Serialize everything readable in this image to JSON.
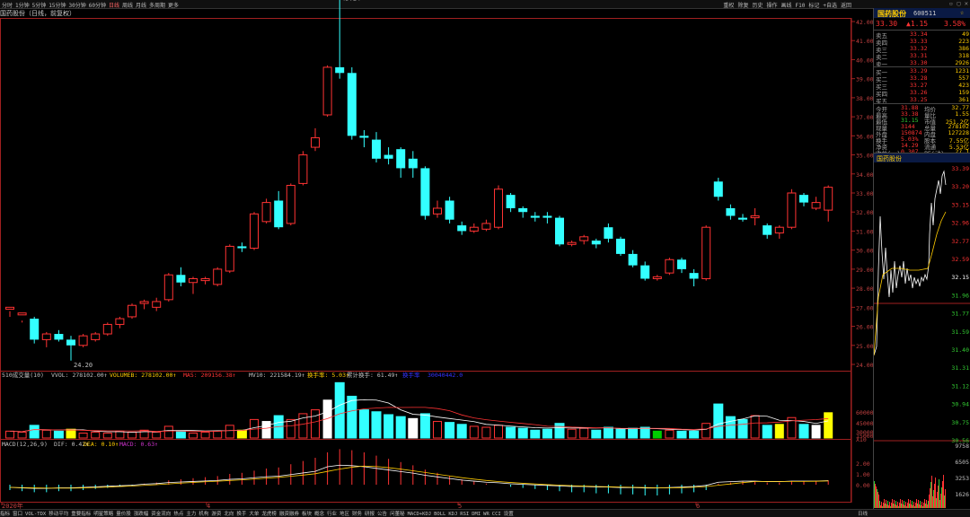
{
  "top_tabs": [
    "分时",
    "1分钟",
    "5分钟",
    "15分钟",
    "30分钟",
    "60分钟",
    "日线",
    "周线",
    "月线",
    "多周期",
    "更多"
  ],
  "top_active_tab": 6,
  "top_right_tabs": [
    "重权",
    "除复",
    "历史",
    "操作",
    "画线",
    "F10",
    "标记",
    "+自选",
    "返回"
  ],
  "stock_header": "国药股份（日线，前复权）",
  "price_axis": [
    "42.00",
    "41.00",
    "40.00",
    "39.00",
    "38.00",
    "37.00",
    "36.00",
    "35.00",
    "34.00",
    "33.00",
    "32.00",
    "31.00",
    "30.00",
    "29.00",
    "28.00",
    "27.00",
    "26.00",
    "25.00",
    "24.00"
  ],
  "annot_high": "43.24",
  "annot_low": "24.20",
  "vol_legend": {
    "a": "510成交量(10)",
    "b": "VVOL: 278102.00↑",
    "c": "VOLUMEB: 278102.00↑",
    "d": "MA5: 209156.38↑",
    "e": "MV10: 221584.19↑",
    "f": "换手率: 5.03↑",
    "g": "累计换手: 61.49↑",
    "h": "换手率",
    "i": "30040442.0"
  },
  "vol_axis": [
    "60000",
    "45000",
    "30000",
    "15000",
    "X10"
  ],
  "macd_legend": {
    "a": "MACD(12,26,9)",
    "b": "DIF: 0.42↑",
    "c": "DEA: 0.10↑",
    "d": "MACD: 0.63↑"
  },
  "macd_axis": [
    "2.00",
    "1.00",
    "0.00"
  ],
  "date_axis": [
    "2020年",
    "4",
    "5",
    "6"
  ],
  "quote": {
    "name": "国药股份",
    "code": "600511",
    "price": "33.30",
    "change": "▲1.15",
    "pct": "3.58%",
    "sells": [
      {
        "l": "卖五",
        "p": "33.34",
        "v": "49"
      },
      {
        "l": "卖四",
        "p": "33.33",
        "v": "223"
      },
      {
        "l": "卖三",
        "p": "33.32",
        "v": "386"
      },
      {
        "l": "卖二",
        "p": "33.31",
        "v": "318"
      },
      {
        "l": "卖一",
        "p": "33.30",
        "v": "2926"
      }
    ],
    "buys": [
      {
        "l": "买一",
        "p": "33.29",
        "v": "1231"
      },
      {
        "l": "买二",
        "p": "33.28",
        "v": "557"
      },
      {
        "l": "买三",
        "p": "33.27",
        "v": "423"
      },
      {
        "l": "买四",
        "p": "33.26",
        "v": "159"
      },
      {
        "l": "买五",
        "p": "33.25",
        "v": "361"
      }
    ],
    "stats": [
      {
        "l": "今开",
        "v": "31.88",
        "l2": "均价",
        "v2": "32.77"
      },
      {
        "l": "最高",
        "v": "33.38",
        "l2": "量比",
        "v2": "1.55"
      },
      {
        "l": "最低",
        "v": "31.15",
        "l2": "市值",
        "v2": "251.2亿"
      },
      {
        "l": "现量",
        "v": "3144",
        "l2": "总量",
        "v2": "278102"
      },
      {
        "l": "外盘",
        "v": "150874",
        "l2": "内盘",
        "v2": "127228"
      },
      {
        "l": "换手",
        "v": "5.03%",
        "l2": "股本",
        "v2": "7.55亿"
      },
      {
        "l": "净资",
        "v": "14.29",
        "l2": "流通",
        "v2": "5.53亿"
      },
      {
        "l": "收益(一)",
        "v": "0.307",
        "l2": "PE(动)",
        "v2": "27.1"
      }
    ],
    "mini_title": "国药股份",
    "mini_axis": [
      "33.39",
      "33.20",
      "33.15",
      "32.96",
      "32.77",
      "32.59",
      "32.15",
      "31.96",
      "31.77",
      "31.59",
      "31.40",
      "31.31",
      "31.12",
      "30.94",
      "30.75",
      "30.56"
    ],
    "mini_vol": [
      "9758",
      "6505",
      "3253",
      "1626"
    ]
  },
  "bottom_tabs": [
    "指标",
    "窗口",
    "VOL-TDX",
    "移动平均",
    "重要指标",
    "明星策略",
    "量价股",
    "涨跌幅",
    "资金流向",
    "热点",
    "主力",
    "机构",
    "游资",
    "北向",
    "换手",
    "大单",
    "龙虎榜",
    "融资融券",
    "板块",
    "概念",
    "行业",
    "地区",
    "财务",
    "研报",
    "公告",
    "问董秘",
    "MACD+KDJ",
    "BOLL",
    "KDJ",
    "RSI",
    "DMI",
    "WR",
    "CCI",
    "设置"
  ],
  "bottom_right": "日线",
  "colors": {
    "up": "#ff3333",
    "down": "#33ffff",
    "ma5": "#ffffff",
    "ma10": "#ffcc00",
    "mline": "#ff3333"
  },
  "candles": [
    [
      26.9,
      27.0,
      26.5,
      26.8
    ],
    [
      26.6,
      26.7,
      26.2,
      26.3
    ],
    [
      26.4,
      25.3,
      25.1,
      26.5
    ],
    [
      25.3,
      25.6,
      24.9,
      25.7
    ],
    [
      25.6,
      25.3,
      25.2,
      25.8
    ],
    [
      25.3,
      25.0,
      24.2,
      25.5
    ],
    [
      25.0,
      25.5,
      24.9,
      25.6
    ],
    [
      25.3,
      25.6,
      25.2,
      25.7
    ],
    [
      25.6,
      26.1,
      25.5,
      26.2
    ],
    [
      26.1,
      26.4,
      25.9,
      26.5
    ],
    [
      26.5,
      27.1,
      26.4,
      27.2
    ],
    [
      27.2,
      27.3,
      26.9,
      27.4
    ],
    [
      27.0,
      27.3,
      26.8,
      27.5
    ],
    [
      27.4,
      28.7,
      27.3,
      28.8
    ],
    [
      28.7,
      28.3,
      28.1,
      29.1
    ],
    [
      28.3,
      28.5,
      27.7,
      28.6
    ],
    [
      28.4,
      28.5,
      28.2,
      28.6
    ],
    [
      28.2,
      29.0,
      28.1,
      29.1
    ],
    [
      28.9,
      30.2,
      28.8,
      30.3
    ],
    [
      30.2,
      30.1,
      29.9,
      30.4
    ],
    [
      30.1,
      31.9,
      30.0,
      32.0
    ],
    [
      31.5,
      32.5,
      31.4,
      32.7
    ],
    [
      32.6,
      31.2,
      31.1,
      33.1
    ],
    [
      31.4,
      33.4,
      31.3,
      33.5
    ],
    [
      33.5,
      35.0,
      33.4,
      35.2
    ],
    [
      35.4,
      35.9,
      35.2,
      36.4
    ],
    [
      37.1,
      39.6,
      37.0,
      39.7
    ],
    [
      39.6,
      39.3,
      39.0,
      43.24
    ],
    [
      39.3,
      36.0,
      35.8,
      39.6
    ],
    [
      36.0,
      35.9,
      35.4,
      36.3
    ],
    [
      35.8,
      34.8,
      34.6,
      36.2
    ],
    [
      35.0,
      34.8,
      34.5,
      35.4
    ],
    [
      35.3,
      34.3,
      33.8,
      35.4
    ],
    [
      34.8,
      34.3,
      33.8,
      35.2
    ],
    [
      34.3,
      31.8,
      31.6,
      34.4
    ],
    [
      31.9,
      32.2,
      31.7,
      32.6
    ],
    [
      32.6,
      31.6,
      31.4,
      32.8
    ],
    [
      31.3,
      31.0,
      30.8,
      31.5
    ],
    [
      31.0,
      31.2,
      30.9,
      31.4
    ],
    [
      31.1,
      31.4,
      31.0,
      31.6
    ],
    [
      31.2,
      33.2,
      31.1,
      33.4
    ],
    [
      32.9,
      32.2,
      32.0,
      33.0
    ],
    [
      32.2,
      32.0,
      31.7,
      32.3
    ],
    [
      31.8,
      31.7,
      31.5,
      32.0
    ],
    [
      31.8,
      31.7,
      31.4,
      32.0
    ],
    [
      31.7,
      30.3,
      30.2,
      31.8
    ],
    [
      30.3,
      30.4,
      30.2,
      30.5
    ],
    [
      30.5,
      30.7,
      30.3,
      30.8
    ],
    [
      30.5,
      30.3,
      30.1,
      30.6
    ],
    [
      31.2,
      30.6,
      30.4,
      31.4
    ],
    [
      30.6,
      29.8,
      29.7,
      30.7
    ],
    [
      29.8,
      29.2,
      29.1,
      30.0
    ],
    [
      29.2,
      28.5,
      28.4,
      29.4
    ],
    [
      28.5,
      28.6,
      28.4,
      28.7
    ],
    [
      28.8,
      29.5,
      28.7,
      29.6
    ],
    [
      29.5,
      29.0,
      28.8,
      29.6
    ],
    [
      28.8,
      28.5,
      28.1,
      29.0
    ],
    [
      28.5,
      31.2,
      28.4,
      31.3
    ],
    [
      33.6,
      32.8,
      32.6,
      33.8
    ],
    [
      32.2,
      31.8,
      31.6,
      32.4
    ],
    [
      31.7,
      31.6,
      31.5,
      31.9
    ],
    [
      31.7,
      31.8,
      31.3,
      32.2
    ],
    [
      31.3,
      30.8,
      30.6,
      31.4
    ],
    [
      30.9,
      31.2,
      30.6,
      31.3
    ],
    [
      31.2,
      33.0,
      31.1,
      33.2
    ],
    [
      32.9,
      32.5,
      32.3,
      33.0
    ],
    [
      32.2,
      32.5,
      32.1,
      32.8
    ],
    [
      32.1,
      33.3,
      31.5,
      33.4
    ]
  ],
  "volumes": [
    8,
    7,
    14,
    9,
    8,
    10,
    6,
    7,
    6,
    8,
    7,
    9,
    7,
    13,
    8,
    6,
    7,
    8,
    14,
    9,
    20,
    18,
    24,
    20,
    26,
    30,
    40,
    58,
    44,
    30,
    28,
    25,
    23,
    21,
    26,
    18,
    17,
    15,
    13,
    12,
    14,
    12,
    11,
    9,
    10,
    16,
    10,
    11,
    9,
    12,
    10,
    11,
    12,
    8,
    9,
    8,
    8,
    16,
    36,
    23,
    20,
    24,
    14,
    15,
    22,
    15,
    14,
    27
  ],
  "vol_special": {
    "5": "y",
    "19": "y",
    "21": "w",
    "26": "w",
    "33": "w",
    "53": "g",
    "63": "y",
    "66": "w",
    "67": "y"
  },
  "macd_hist": [
    -0.5,
    -0.6,
    -0.7,
    -0.7,
    -0.6,
    -0.6,
    -0.5,
    -0.4,
    -0.3,
    -0.2,
    -0.1,
    0.1,
    0.2,
    0.4,
    0.5,
    0.6,
    0.7,
    0.8,
    1.0,
    1.1,
    1.3,
    1.5,
    1.6,
    1.9,
    2.2,
    2.5,
    3.0,
    3.3,
    3.2,
    3.0,
    2.7,
    2.4,
    2.1,
    1.8,
    1.4,
    1.1,
    0.8,
    0.5,
    0.3,
    0.1,
    0.0,
    -0.2,
    -0.3,
    -0.4,
    -0.5,
    -0.6,
    -0.7,
    -0.7,
    -0.8,
    -0.8,
    -0.9,
    -0.9,
    -1.0,
    -1.0,
    -0.9,
    -0.8,
    -0.7,
    -0.5,
    0.1,
    0.2,
    0.3,
    0.3,
    0.2,
    0.2,
    0.3,
    0.3,
    0.3,
    0.4
  ]
}
